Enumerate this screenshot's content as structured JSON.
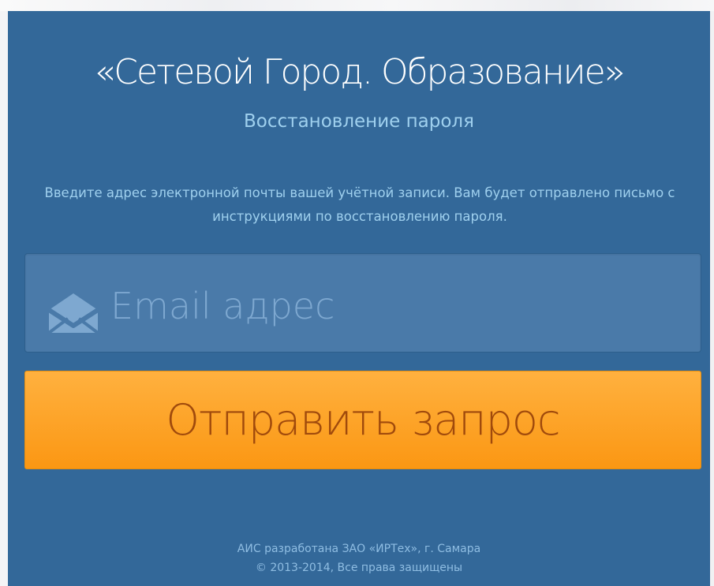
{
  "page": {
    "title": "«Сетевой Город. Образование»",
    "subtitle": "Восстановление пароля",
    "instructions": "Введите адрес электронной почты вашей учётной записи. Вам будет отправлено письмо с инструкциями по восстановлению пароля."
  },
  "form": {
    "email_icon": "envelope-icon",
    "email_placeholder": "Email адрес",
    "email_value": "",
    "submit_label": "Отправить запрос"
  },
  "footer": {
    "line1": "АИС разработана ЗАО «ИРТех», г. Самара",
    "line2": "© 2013-2014, Все права защищены"
  },
  "colors": {
    "panel_background": "#336899",
    "subtitle_text": "#9fd0ee",
    "input_background": "#4a7aa9",
    "button_background": "#fb9713",
    "button_text": "#a04a0c"
  }
}
